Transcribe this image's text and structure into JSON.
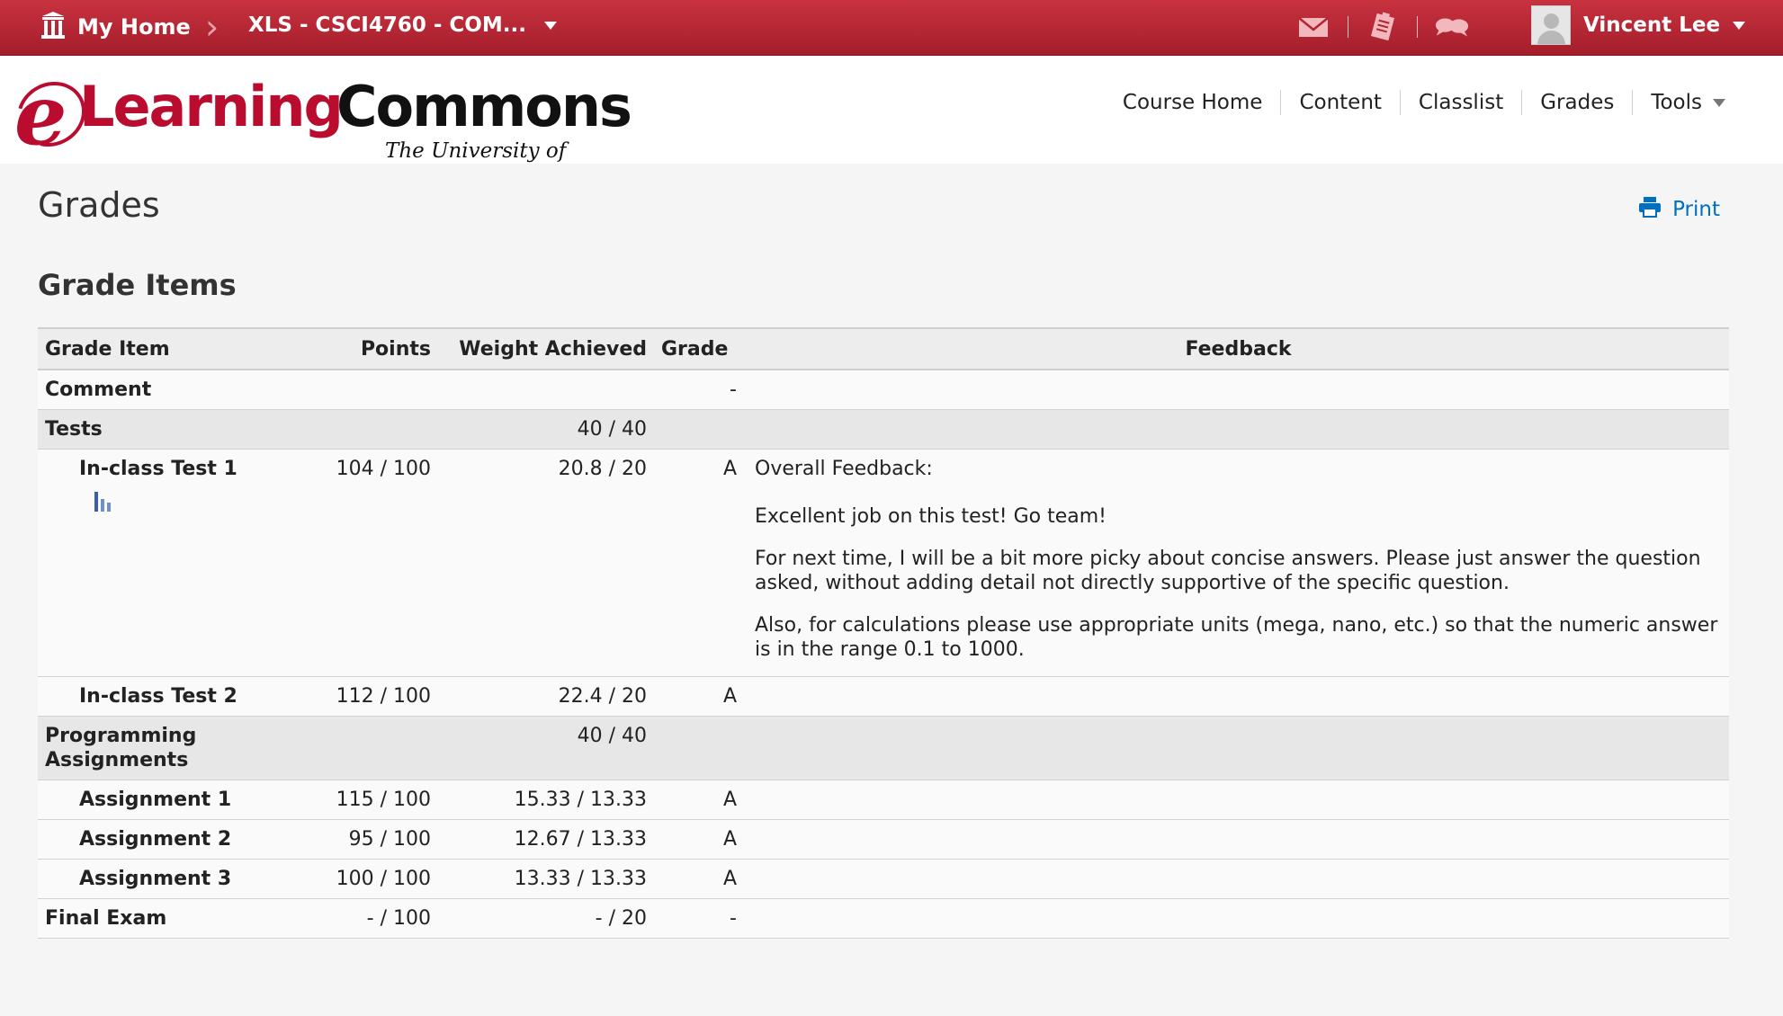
{
  "topbar": {
    "home_label": "My Home",
    "course_label": "XLS - CSCI4760 - COM...",
    "user_name": "Vincent Lee",
    "icons": [
      "mail-icon",
      "notes-icon",
      "chat-icon"
    ]
  },
  "logo": {
    "e": "e",
    "learning": "Learning",
    "commons": "Commons",
    "university": "The University of Georgia"
  },
  "nav": {
    "course_home": "Course Home",
    "content": "Content",
    "classlist": "Classlist",
    "grades": "Grades",
    "tools": "Tools"
  },
  "page": {
    "title": "Grades",
    "print_label": "Print",
    "section_title": "Grade Items"
  },
  "table": {
    "headers": {
      "item": "Grade Item",
      "points": "Points",
      "weight": "Weight Achieved",
      "grade": "Grade",
      "feedback": "Feedback"
    },
    "comment": {
      "label": "Comment",
      "grade": "-"
    },
    "tests": {
      "label": "Tests",
      "weight": "40 / 40"
    },
    "test1": {
      "label": "In-class Test 1",
      "points": "104 / 100",
      "weight": "20.8 / 20",
      "grade": "A",
      "feedback_head": "Overall Feedback:",
      "feedback_p1": "Excellent job  on this test! Go team!",
      "feedback_p2": "For next time, I will be a bit more picky about concise answers. Please just answer the question asked, without adding detail not directly supportive of the specific question.",
      "feedback_p3": "Also, for calculations please use appropriate units (mega, nano, etc.)  so that the numeric answer is in the range 0.1 to 1000."
    },
    "test2": {
      "label": "In-class Test 2",
      "points": "112 / 100",
      "weight": "22.4 / 20",
      "grade": "A"
    },
    "programming": {
      "label": "Programming Assignments",
      "weight": "40 / 40"
    },
    "a1": {
      "label": "Assignment 1",
      "points": "115 / 100",
      "weight": "15.33 / 13.33",
      "grade": "A"
    },
    "a2": {
      "label": "Assignment 2",
      "points": "95 / 100",
      "weight": "12.67 / 13.33",
      "grade": "A"
    },
    "a3": {
      "label": "Assignment 3",
      "points": "100 / 100",
      "weight": "13.33 / 13.33",
      "grade": "A"
    },
    "final": {
      "label": "Final Exam",
      "points": "- / 100",
      "weight": "- / 20",
      "grade": "-"
    }
  },
  "colors": {
    "brand_red": "#ba0c2f",
    "topbar_red": "#b3242f",
    "link_blue": "#006fbf"
  }
}
